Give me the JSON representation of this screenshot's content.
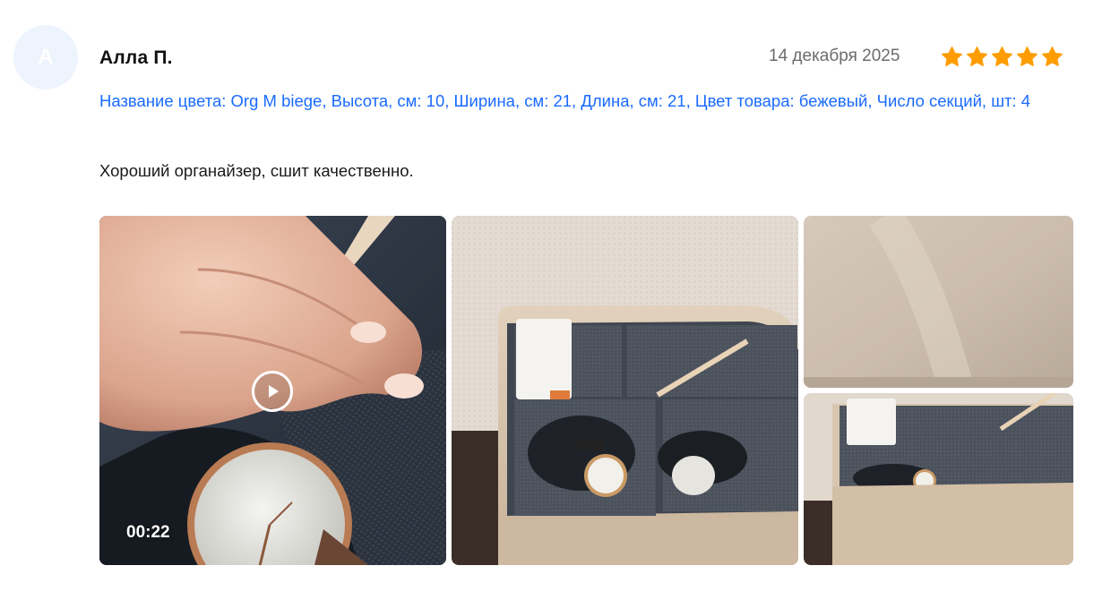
{
  "review": {
    "avatar_initial": "А",
    "author": "Алла П.",
    "date": "14 декабря 2025",
    "rating": 5,
    "rating_color": "#ff9d00",
    "props_text": "Название цвета: Org M biege, Высота, см: 10, Ширина, см: 21, Длина, см: 21, Цвет товара: бежевый, Число секций, шт: 4",
    "text": "Хороший органайзер, сшит качественно."
  },
  "media": {
    "video": {
      "duration": "00:22",
      "icon": "play-icon"
    },
    "photos": [
      {
        "name": "photo-organizer-open"
      },
      {
        "name": "photo-organizer-lid"
      },
      {
        "name": "photo-organizer-top"
      }
    ]
  }
}
